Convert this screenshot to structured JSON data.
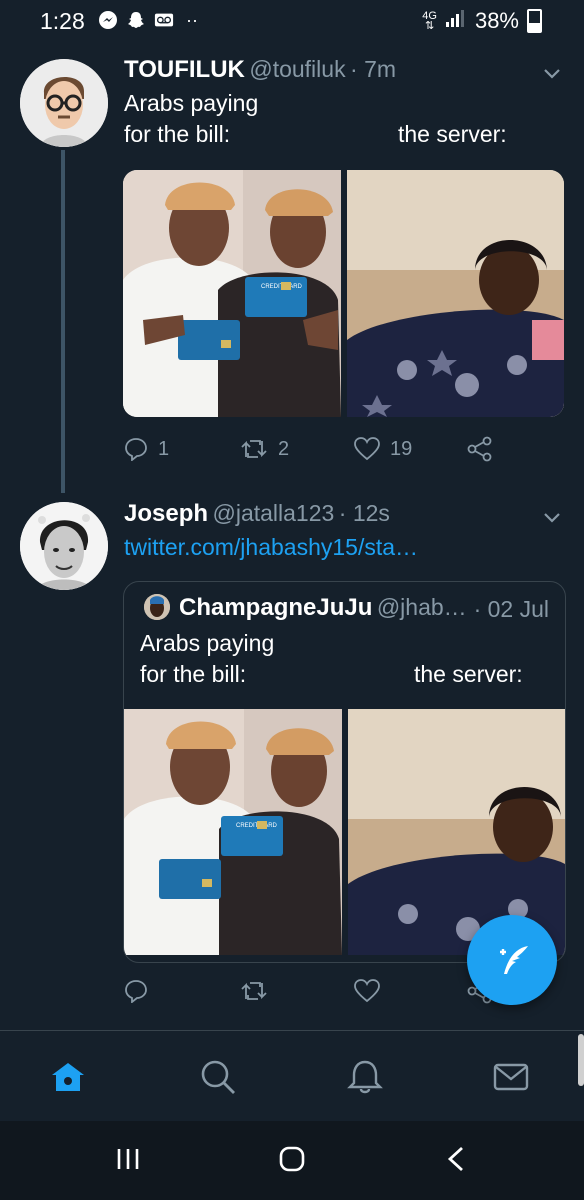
{
  "status_bar": {
    "time": "1:28",
    "network": "4G",
    "battery": "38%"
  },
  "tweets": [
    {
      "name": "TOUFILUK",
      "handle": "@toufiluk",
      "time": "· 7m",
      "text_line1": "Arabs paying",
      "text_line2_left": "for the bill:",
      "text_line2_right": "the server:",
      "replies": "1",
      "retweets": "2",
      "likes": "19"
    },
    {
      "name": "Joseph",
      "handle": "@jatalla123",
      "time": "· 12s",
      "link": "twitter.com/jhabashy15/sta…"
    }
  ],
  "quoted": {
    "name": "ChampagneJuJu",
    "handle": "@jhab…",
    "date": "· 02 Jul",
    "text_line1": "Arabs paying",
    "text_line2_left": "for the bill:",
    "text_line2_right": "the server:"
  },
  "card_text": "CREDIT CARD",
  "colors": {
    "accent": "#1da1f2",
    "background": "#15202b",
    "secondary_text": "#8899a6",
    "border": "#38444d"
  },
  "icons": [
    "messenger-icon",
    "snapchat-icon",
    "voicemail-icon",
    "signal-icon",
    "battery-icon",
    "chevron-down-icon",
    "reply-icon",
    "retweet-icon",
    "like-icon",
    "share-icon",
    "compose-icon",
    "home-icon",
    "search-icon",
    "notifications-icon",
    "messages-icon"
  ]
}
